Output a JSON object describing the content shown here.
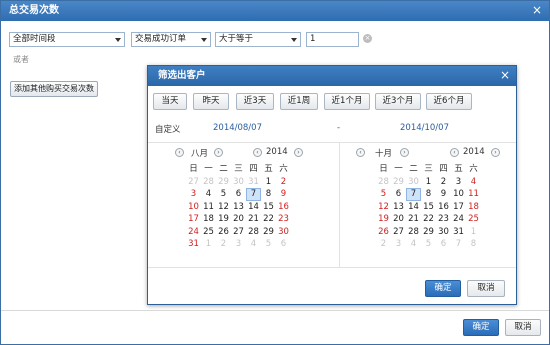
{
  "dialog": {
    "title": "总交易次数",
    "close_glyph": "×",
    "filters": {
      "time_range": "全部时间段",
      "order_type": "交易成功订单",
      "operator": "大于等于",
      "value": "1",
      "clear_glyph": "×"
    },
    "or_text": "或者",
    "add_button": "添加其他购买交易次数",
    "ok_label": "确定",
    "cancel_label": "取消"
  },
  "subdialog": {
    "title": "筛选出客户",
    "close_glyph": "×",
    "quick_ranges": [
      "当天",
      "昨天",
      "近3天",
      "近1周",
      "近1个月",
      "近3个月",
      "近6个月"
    ],
    "custom_label": "自定义",
    "start_date": "2014/08/07",
    "range_sep": "-",
    "end_date": "2014/10/07",
    "ok_label": "确定",
    "cancel_label": "取消"
  },
  "calendars": {
    "weekdays": [
      "日",
      "一",
      "二",
      "三",
      "四",
      "五",
      "六"
    ],
    "left": {
      "month": "八月",
      "year": "2014",
      "selected": "7",
      "weeks": [
        [
          "27",
          "28",
          "29",
          "30",
          "31",
          "1",
          "2"
        ],
        [
          "3",
          "4",
          "5",
          "6",
          "7",
          "8",
          "9"
        ],
        [
          "10",
          "11",
          "12",
          "13",
          "14",
          "15",
          "16"
        ],
        [
          "17",
          "18",
          "19",
          "20",
          "21",
          "22",
          "23"
        ],
        [
          "24",
          "25",
          "26",
          "27",
          "28",
          "29",
          "30"
        ],
        [
          "31",
          "1",
          "2",
          "3",
          "4",
          "5",
          "6"
        ]
      ]
    },
    "right": {
      "month": "十月",
      "year": "2014",
      "selected": "7",
      "weeks": [
        [
          "28",
          "29",
          "30",
          "1",
          "2",
          "3",
          "4"
        ],
        [
          "5",
          "6",
          "7",
          "8",
          "9",
          "10",
          "11"
        ],
        [
          "12",
          "13",
          "14",
          "15",
          "16",
          "17",
          "18"
        ],
        [
          "19",
          "20",
          "21",
          "22",
          "23",
          "24",
          "25"
        ],
        [
          "26",
          "27",
          "28",
          "29",
          "30",
          "31",
          "1"
        ],
        [
          "2",
          "3",
          "4",
          "5",
          "6",
          "7",
          "8"
        ]
      ]
    }
  },
  "colors": {
    "title_bar": "#2e6db0",
    "primary_button": "#2a6cb8",
    "weekend_text": "#d02020",
    "other_month_text": "#c4c4c4",
    "selected_day_bg": "#cfe2f7"
  },
  "icons": {
    "prev_month": "‹",
    "next_month": "›",
    "prev_year": "‹",
    "next_year": "›"
  }
}
